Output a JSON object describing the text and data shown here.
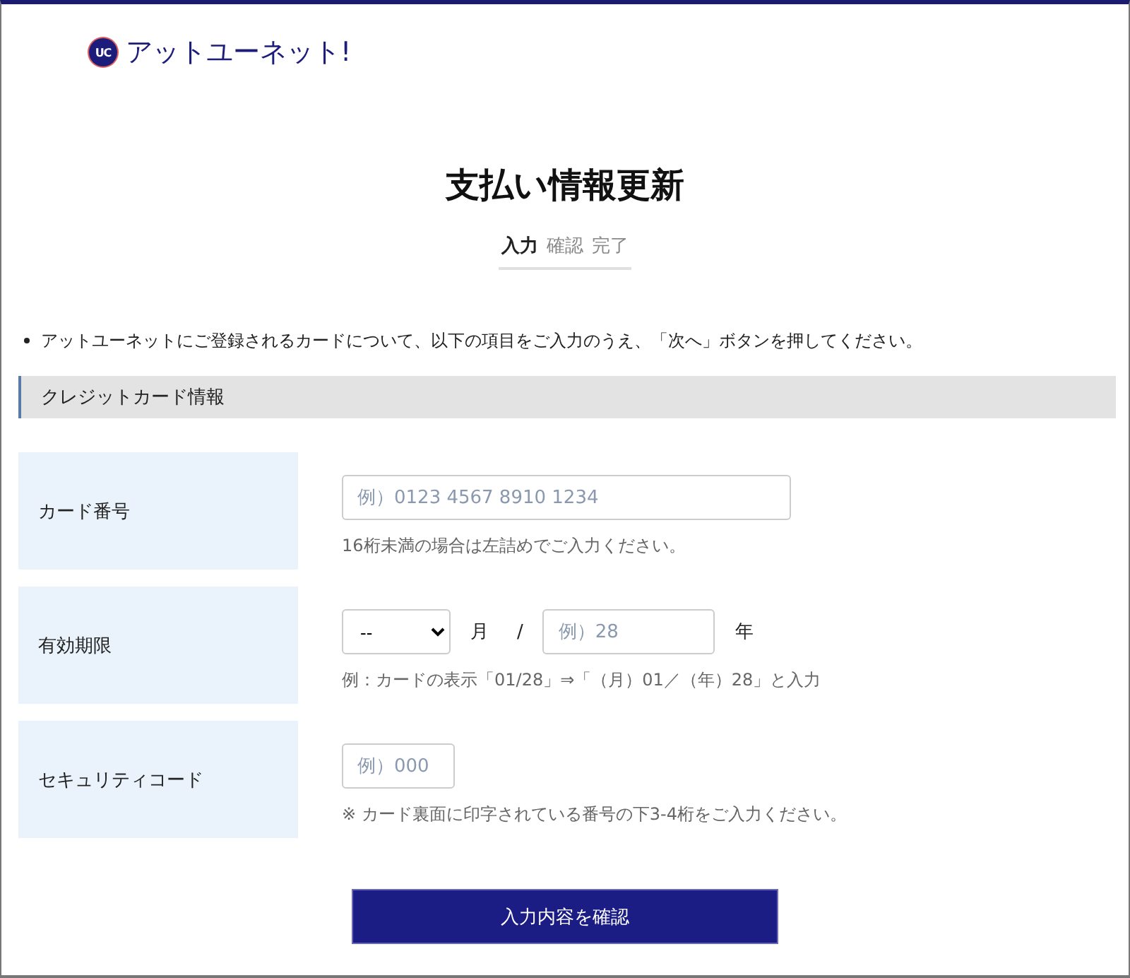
{
  "header": {
    "logo_mark": "UC",
    "logo_text": "アットユーネット!"
  },
  "title": "支払い情報更新",
  "steps": [
    {
      "label": "入力",
      "selected": true
    },
    {
      "label": "確認",
      "selected": false
    },
    {
      "label": "完了",
      "selected": false
    }
  ],
  "notes": [
    "アットユーネットにご登録されるカードについて、以下の項目をご入力のうえ、「次へ」ボタンを押してください。"
  ],
  "section": {
    "title": "クレジットカード情報"
  },
  "fields": [
    {
      "kind": "text",
      "label": "カード番号",
      "placeholder": "例）0123 4567 8910 1234",
      "hint": "16桁未満の場合は左詰めでご入力ください。"
    },
    {
      "kind": "expiry",
      "label": "有効期限",
      "month_value": "--",
      "month_unit": "月",
      "separator": "/",
      "placeholder": "例）28",
      "year_unit": "年",
      "hint": "例：カードの表示「01/28」⇒「（月）01／（年）28」と入力"
    },
    {
      "kind": "short",
      "label": "セキュリティコード",
      "placeholder": "例）000",
      "hint": "※ カード裏面に印字されている番号の下3-4桁をご入力ください。"
    }
  ],
  "submit": "入力内容を確認"
}
